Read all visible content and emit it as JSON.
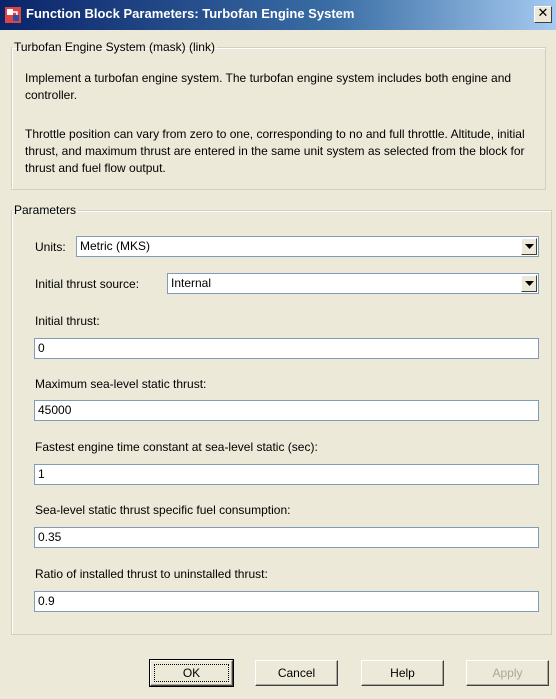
{
  "window": {
    "title": "Function Block Parameters: Turbofan Engine System",
    "close_glyph": "✕",
    "icon": "simulink-block-icon"
  },
  "description_group": {
    "legend": "Turbofan Engine System (mask) (link)",
    "paragraph1": "Implement a turbofan engine system. The turbofan engine system includes both engine and controller.",
    "paragraph2": "Throttle position can vary from zero to one, corresponding to no and full throttle. Altitude, initial thrust, and maximum thrust are entered in the same unit system as selected from the block for thrust and fuel flow output."
  },
  "parameters_group": {
    "legend": "Parameters",
    "units": {
      "label": "Units:",
      "value": "Metric (MKS)"
    },
    "thrust_source": {
      "label": "Initial thrust source:",
      "value": "Internal"
    },
    "initial_thrust": {
      "label": "Initial thrust:",
      "value": "0"
    },
    "max_thrust": {
      "label": "Maximum sea-level static thrust:",
      "value": "45000"
    },
    "time_constant": {
      "label": "Fastest engine time constant at sea-level static (sec):",
      "value": "1"
    },
    "tsfc": {
      "label": "Sea-level static thrust specific fuel consumption:",
      "value": "0.35"
    },
    "ratio": {
      "label": "Ratio of installed thrust to uninstalled thrust:",
      "value": "0.9"
    }
  },
  "buttons": {
    "ok": "OK",
    "cancel": "Cancel",
    "help": "Help",
    "apply": "Apply"
  }
}
